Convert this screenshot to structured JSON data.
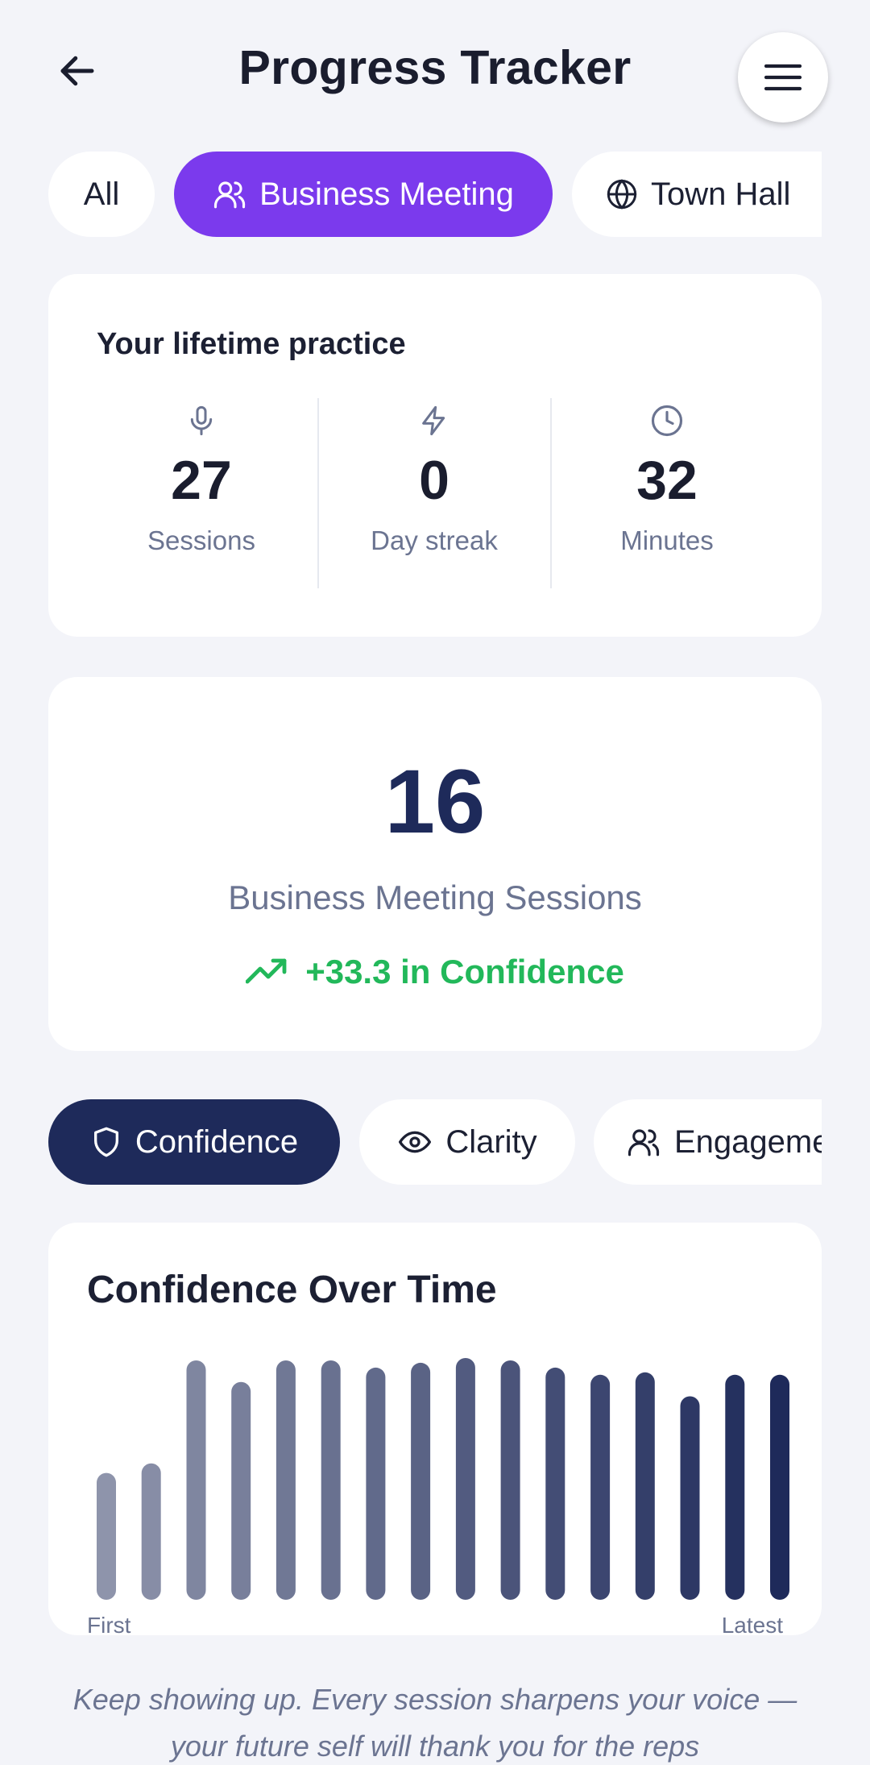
{
  "header": {
    "title": "Progress Tracker",
    "back_icon": "arrow-left-icon",
    "menu_icon": "hamburger-menu-icon"
  },
  "filters": [
    {
      "label": "All",
      "active": false,
      "icon": null
    },
    {
      "label": "Business Meeting",
      "active": true,
      "icon": "users-icon"
    },
    {
      "label": "Town Hall",
      "active": false,
      "icon": "globe-icon"
    }
  ],
  "lifetime": {
    "title": "Your lifetime practice",
    "stats": [
      {
        "icon": "microphone-icon",
        "value": "27",
        "label": "Sessions"
      },
      {
        "icon": "lightning-icon",
        "value": "0",
        "label": "Day streak"
      },
      {
        "icon": "clock-icon",
        "value": "32",
        "label": "Minutes"
      }
    ]
  },
  "summary": {
    "count": "16",
    "label": "Business Meeting Sessions",
    "trend_icon": "trending-up-icon",
    "trend_text": "+33.3 in Confidence",
    "trend_color": "#22b85a"
  },
  "metrics": [
    {
      "label": "Confidence",
      "active": true,
      "icon": "shield-icon"
    },
    {
      "label": "Clarity",
      "active": false,
      "icon": "eye-icon"
    },
    {
      "label": "Engagement",
      "active": false,
      "icon": "users-icon"
    }
  ],
  "chart_data": {
    "type": "bar",
    "title": "Confidence Over Time",
    "x_start_label": "First",
    "x_end_label": "Latest",
    "values": [
      53,
      57,
      100,
      91,
      100,
      100,
      97,
      99,
      101,
      100,
      97,
      94,
      95,
      85,
      94,
      94
    ],
    "ylim": [
      0,
      101
    ],
    "grid": false,
    "color_start": "#8e94ab",
    "color_end": "#1e2a5a"
  },
  "footer": {
    "text": "Keep showing up. Every session sharpens your voice — your future self will thank you for the reps"
  },
  "colors": {
    "accent": "#7b3aed",
    "navy": "#1e2a5a",
    "background": "#f3f4f9",
    "muted_text": "#6b7491"
  }
}
